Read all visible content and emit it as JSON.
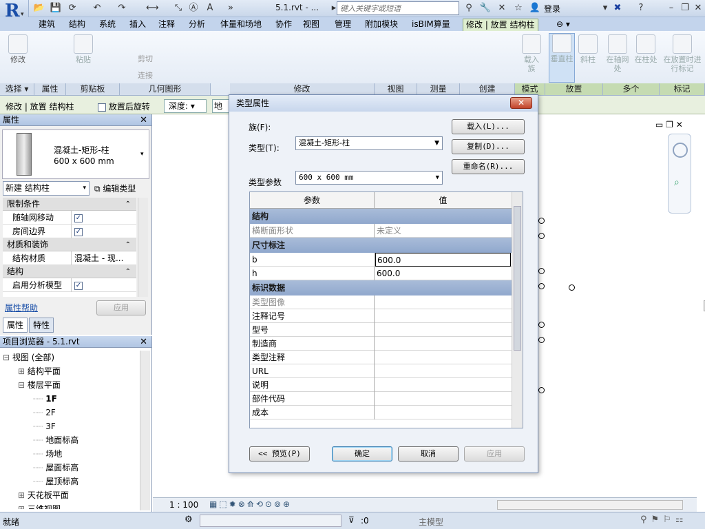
{
  "titlebar": {
    "file_title": "5.1.rvt - ...",
    "search_placeholder": "键入关键字或短语",
    "login": "登录"
  },
  "tabs": [
    "建筑",
    "结构",
    "系统",
    "插入",
    "注释",
    "分析",
    "体量和场地",
    "协作",
    "视图",
    "管理",
    "附加模块",
    "isBIM算量",
    "修改 | 放置 结构柱"
  ],
  "ribbon": {
    "modify": "修改",
    "paste": "粘贴",
    "cut": "剪切",
    "join": "连接",
    "load_family": "载入族",
    "vertical_column": "垂直柱",
    "slanted_column": "斜柱",
    "at_grids": "在轴网处",
    "at_columns": "在柱处",
    "tag_on_place": "在放置时进行标记",
    "footers": [
      "选择 ▾",
      "属性",
      "剪贴板",
      "几何图形",
      "修改",
      "视图",
      "测量",
      "创建",
      "模式",
      "放置",
      "多个",
      "标记"
    ]
  },
  "optionsbar": {
    "context": "修改 | 放置 结构柱",
    "rotate_after_place": "放置后旋转",
    "depth_label": "深度:",
    "level_partial": "地面"
  },
  "properties": {
    "title": "属性",
    "type_name": "混凝土-矩形-柱",
    "type_size": "600 x 600 mm",
    "instance_selector": "新建 结构柱",
    "edit_type": "编辑类型",
    "groups": [
      {
        "name": "限制条件",
        "rows": [
          {
            "k": "随轴网移动",
            "v": "✓"
          },
          {
            "k": "房间边界",
            "v": "✓"
          }
        ]
      },
      {
        "name": "材质和装饰",
        "rows": [
          {
            "k": "结构材质",
            "v": "混凝土 - 现..."
          }
        ]
      },
      {
        "name": "结构",
        "rows": [
          {
            "k": "启用分析模型",
            "v": "✓"
          }
        ]
      }
    ],
    "help": "属性帮助",
    "apply": "应用",
    "tab_props": "属性",
    "tab_traits": "特性"
  },
  "browser": {
    "title": "项目浏览器 - 5.1.rvt",
    "items": [
      {
        "label": "视图 (全部)",
        "indent": 0,
        "toggle": "⊟"
      },
      {
        "label": "结构平面",
        "indent": 1,
        "toggle": "⊞"
      },
      {
        "label": "楼层平面",
        "indent": 1,
        "toggle": "⊟"
      },
      {
        "label": "1F",
        "indent": 2,
        "toggle": ""
      },
      {
        "label": "2F",
        "indent": 2,
        "toggle": ""
      },
      {
        "label": "3F",
        "indent": 2,
        "toggle": ""
      },
      {
        "label": "地面标高",
        "indent": 2,
        "toggle": ""
      },
      {
        "label": "场地",
        "indent": 2,
        "toggle": ""
      },
      {
        "label": "屋面标高",
        "indent": 2,
        "toggle": ""
      },
      {
        "label": "屋顶标高",
        "indent": 2,
        "toggle": ""
      },
      {
        "label": "天花板平面",
        "indent": 1,
        "toggle": "⊞"
      },
      {
        "label": "三维视图",
        "indent": 1,
        "toggle": "⊞"
      }
    ]
  },
  "viewbar": {
    "scale": "1 : 100"
  },
  "statusbar": {
    "ready": "就绪",
    "coord": ":0",
    "model": "主模型"
  },
  "dialog": {
    "title": "类型属性",
    "family_label": "族(F):",
    "family_value": "混凝土-矩形-柱",
    "type_label": "类型(T):",
    "type_value": "600 x 600 mm",
    "load_btn": "载入(L)...",
    "duplicate_btn": "复制(D)...",
    "rename_btn": "重命名(R)...",
    "type_params": "类型参数",
    "col_param": "参数",
    "col_value": "值",
    "groups": [
      {
        "name": "结构",
        "rows": [
          {
            "k": "横断面形状",
            "v": "未定义",
            "ro": true
          }
        ]
      },
      {
        "name": "尺寸标注",
        "rows": [
          {
            "k": "b",
            "v": "600.0"
          },
          {
            "k": "h",
            "v": "600.0"
          }
        ]
      },
      {
        "name": "标识数据",
        "rows": [
          {
            "k": "类型图像",
            "v": "",
            "ro": true
          },
          {
            "k": "注释记号",
            "v": ""
          },
          {
            "k": "型号",
            "v": ""
          },
          {
            "k": "制造商",
            "v": ""
          },
          {
            "k": "类型注释",
            "v": ""
          },
          {
            "k": "URL",
            "v": ""
          },
          {
            "k": "说明",
            "v": ""
          },
          {
            "k": "部件代码",
            "v": ""
          },
          {
            "k": "成本",
            "v": ""
          }
        ]
      }
    ],
    "preview_btn": "<< 预览(P)",
    "ok_btn": "确定",
    "cancel_btn": "取消",
    "apply_btn": "应用"
  }
}
